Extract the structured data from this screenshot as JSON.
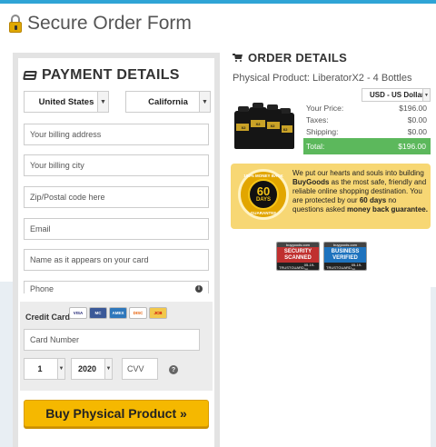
{
  "page": {
    "title": "Secure Order Form"
  },
  "payment": {
    "heading": "PAYMENT DETAILS",
    "country": "United States",
    "state": "California",
    "fields": {
      "address_placeholder": "Your billing address",
      "city_placeholder": "Your billing city",
      "zip_placeholder": "Zip/Postal code here",
      "email_placeholder": "Email",
      "name_placeholder": "Name as it appears on your card",
      "phone_placeholder": "Phone"
    },
    "credit_card": {
      "label": "Credit Card",
      "brands": [
        "VISA",
        "MC",
        "AMEX",
        "DISC",
        "JCB"
      ],
      "number_placeholder": "Card Number",
      "month": "1",
      "year": "2020",
      "cvv_placeholder": "CVV"
    },
    "buy_button": "Buy Physical Product »"
  },
  "order": {
    "heading": "ORDER DETAILS",
    "product": "Physical Product: LiberatorX2 - 4 Bottles",
    "currency": "USD - US Dollar",
    "rows": [
      {
        "label": "Your Price:",
        "value": "$196.00"
      },
      {
        "label": "Taxes:",
        "value": "$0.00"
      },
      {
        "label": "Shipping:",
        "value": "$0.00"
      }
    ],
    "total": {
      "label": "Total:",
      "value": "$196.00"
    },
    "bottle_label": "X2"
  },
  "guarantee": {
    "seal_top": "100% MONEY BACK",
    "seal_days": "60",
    "seal_days_label": "DAYS",
    "seal_bottom": "GUARANTEE",
    "text_1": "We put our hearts and souls into building ",
    "brand": "BuyGoods",
    "text_2": " as the most safe, friendly and reliable online shopping destination. You are protected by our ",
    "days": "60 days",
    "text_3": " no questions asked ",
    "mbg": "money back guarantee."
  },
  "badges": {
    "security": {
      "top": "buygoods.com",
      "line1": "SECURITY",
      "line2": "SCANNED",
      "foot_l": "TRUST",
      "foot_r": "GUARD",
      "date": "05-19-20"
    },
    "business": {
      "top": "buygoods.com",
      "line1": "BUSINESS",
      "line2": "VERIFIED",
      "foot_l": "TRUST",
      "foot_r": "GUARD",
      "date": "05-19-20"
    }
  },
  "colors": {
    "accent": "#2fa4d6",
    "buy_button": "#f5b800",
    "total_bar": "#5cb85c",
    "guarantee_bg": "#f7d774"
  }
}
